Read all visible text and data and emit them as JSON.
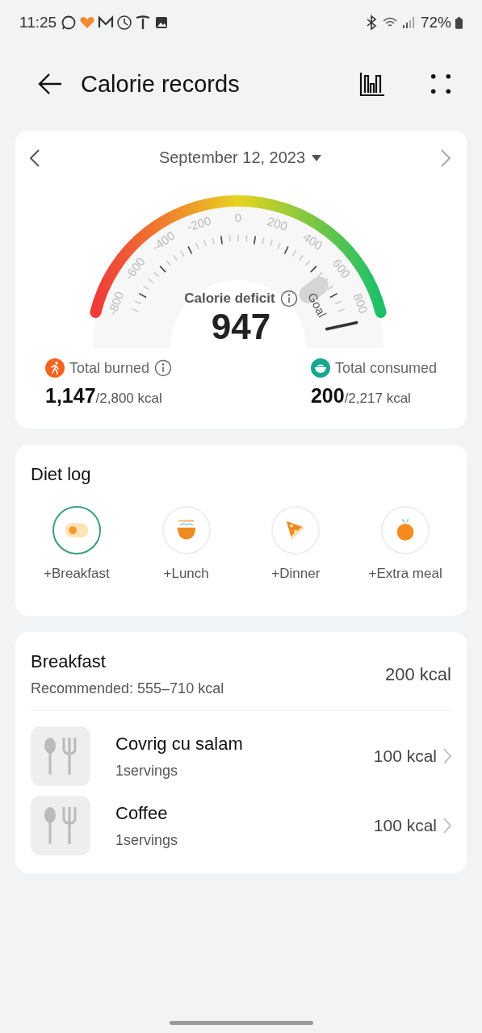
{
  "status_bar": {
    "time": "11:25",
    "battery": "72%"
  },
  "header": {
    "title": "Calorie records"
  },
  "summary": {
    "date": "September 12, 2023",
    "gauge": {
      "tick_labels": [
        "-800",
        "-600",
        "-400",
        "-200",
        "0",
        "200",
        "400",
        "600",
        "800"
      ],
      "goal_label": "Goal",
      "title": "Calorie deficit",
      "value": "947"
    },
    "burned": {
      "label": "Total burned",
      "value": "1,147",
      "target": "/2,800 kcal"
    },
    "consumed": {
      "label": "Total consumed",
      "value": "200",
      "target": "/2,217 kcal"
    }
  },
  "diet_log": {
    "title": "Diet log",
    "meals": [
      {
        "label": "+Breakfast",
        "kind": "egg",
        "selected": true
      },
      {
        "label": "+Lunch",
        "kind": "bowl",
        "selected": false
      },
      {
        "label": "+Dinner",
        "kind": "pizza",
        "selected": false
      },
      {
        "label": "+Extra meal",
        "kind": "fruit",
        "selected": false
      }
    ]
  },
  "meal_detail": {
    "title": "Breakfast",
    "recommended": "Recommended: 555–710 kcal",
    "total": "200 kcal",
    "items": [
      {
        "name": "Covrig cu salam",
        "servings": "1servings",
        "kcal": "100 kcal"
      },
      {
        "name": "Coffee",
        "servings": "1servings",
        "kcal": "100 kcal"
      }
    ]
  }
}
